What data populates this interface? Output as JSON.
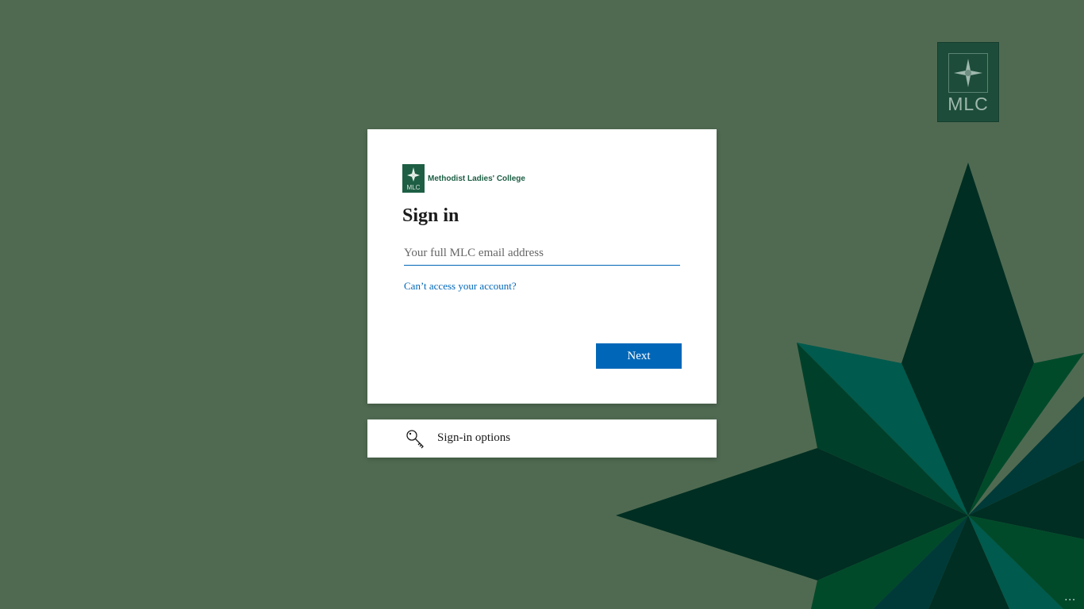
{
  "corner_logo": {
    "text": "MLC"
  },
  "card": {
    "brand_mark": "MLC",
    "brand_name": "Methodist Ladies' College",
    "title": "Sign in",
    "email_placeholder": "Your full MLC email address",
    "email_value": "",
    "cant_access_link": "Can’t access your account?",
    "next_label": "Next"
  },
  "options": {
    "label": "Sign-in options",
    "icon": "key-icon"
  },
  "footer": {
    "more_label": "..."
  },
  "colors": {
    "background": "#506a52",
    "accent": "#0067b8",
    "brand_green": "#1d5e44"
  }
}
